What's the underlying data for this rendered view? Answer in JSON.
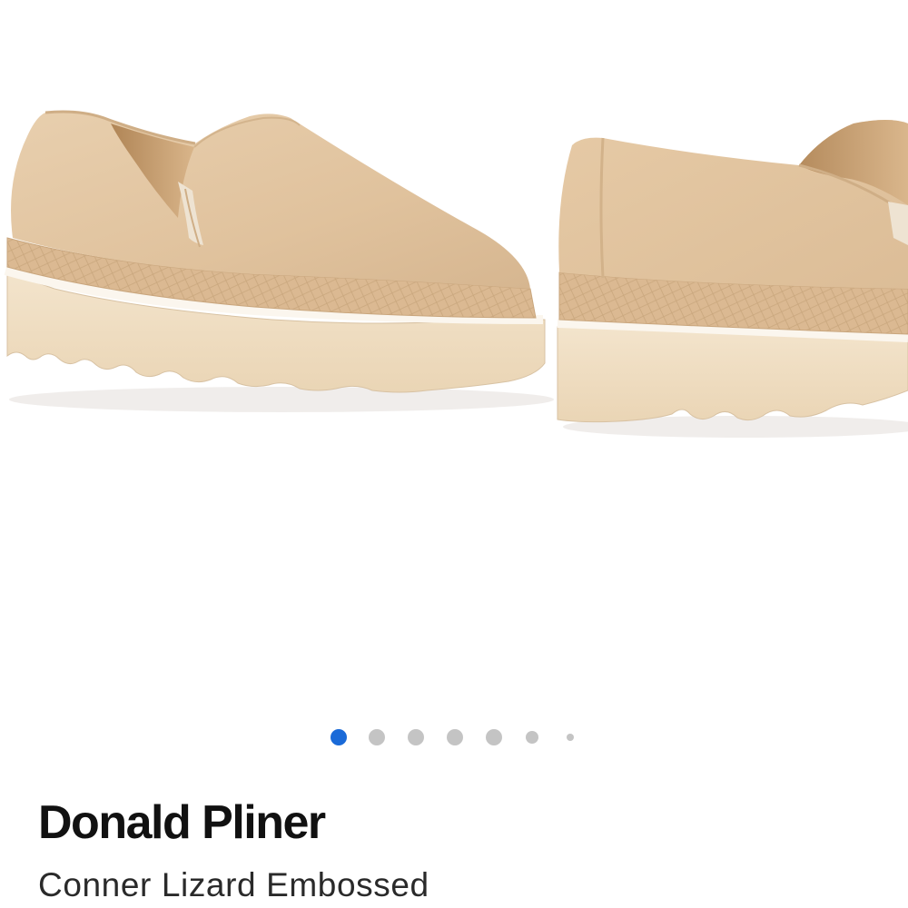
{
  "gallery": {
    "image_alt": "Tan suede loafer with lizard embossed trim and lug sole",
    "current_index": 1,
    "total_images": 7,
    "active_dot_color": "#1a6ad8",
    "inactive_dot_color": "#c4c4c4"
  },
  "product": {
    "brand": "Donald Pliner",
    "name": "Conner Lizard Embossed"
  },
  "colors": {
    "suede": "#e2c6a3",
    "lizard_trim": "#dcbb95",
    "sole": "#f0dec3",
    "welt": "#fbf6ee"
  }
}
